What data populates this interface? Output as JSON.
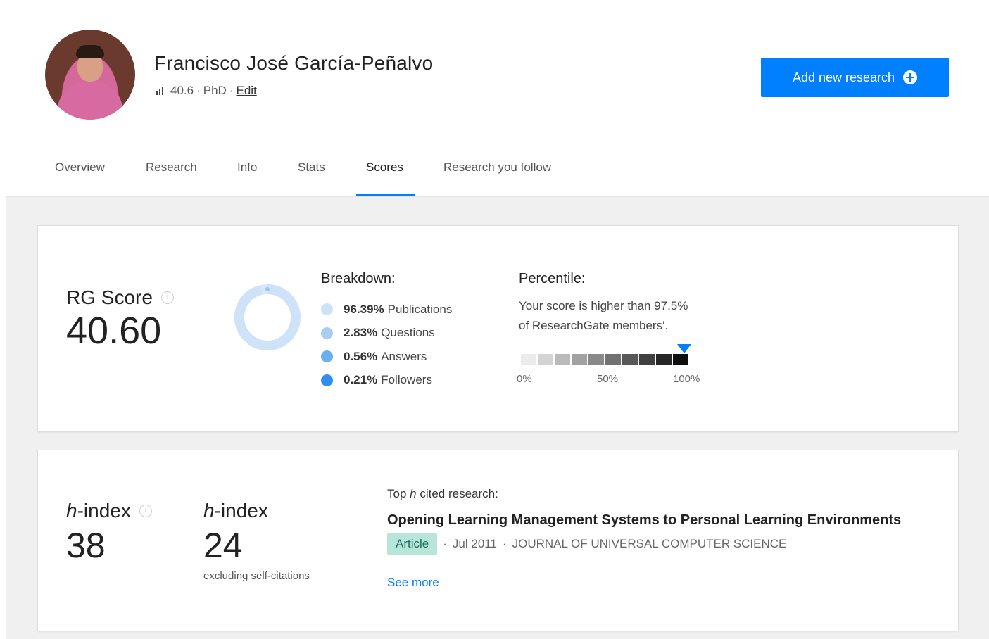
{
  "profile": {
    "name": "Francisco José García-Peñalvo",
    "score": "40.6",
    "degree": "PhD",
    "edit_label": "Edit",
    "add_button_label": "Add new research",
    "separator": "·"
  },
  "tabs": [
    {
      "label": "Overview"
    },
    {
      "label": "Research"
    },
    {
      "label": "Info"
    },
    {
      "label": "Stats"
    },
    {
      "label": "Scores"
    },
    {
      "label": "Research you follow"
    }
  ],
  "active_tab": "Scores",
  "rg_score": {
    "label": "RG Score",
    "value": "40.60",
    "info_icon": "info-icon"
  },
  "breakdown": {
    "title": "Breakdown:",
    "items": [
      {
        "percent": "96.39%",
        "label": "Publications",
        "color": "#cfe3f8"
      },
      {
        "percent": "2.83%",
        "label": "Questions",
        "color": "#a9cdf2"
      },
      {
        "percent": "0.56%",
        "label": "Answers",
        "color": "#6caff0"
      },
      {
        "percent": "0.21%",
        "label": "Followers",
        "color": "#2f8ef0"
      }
    ]
  },
  "percentile": {
    "title": "Percentile:",
    "text_line1": "Your score is higher than 97.5%",
    "text_line2": "of ResearchGate members'.",
    "value": 97.5,
    "axis": [
      "0%",
      "50%",
      "100%"
    ]
  },
  "h_index": {
    "label_italic": "h",
    "label_rest": "-index",
    "value": "38",
    "excl_label_italic": "h",
    "excl_label_rest": "-index",
    "excl_value": "24",
    "excl_note": "excluding self-citations"
  },
  "top_cited": {
    "label_prefix": "Top ",
    "label_italic": "h",
    "label_suffix": " cited research:",
    "title": "Opening Learning Management Systems to Personal Learning Environments",
    "type_badge": "Article",
    "date": "Jul 2011",
    "journal": "JOURNAL OF UNIVERSAL COMPUTER SCIENCE",
    "see_more": "See more"
  },
  "colors": {
    "accent": "#0080ff",
    "badge_bg": "#b8e5d9"
  }
}
